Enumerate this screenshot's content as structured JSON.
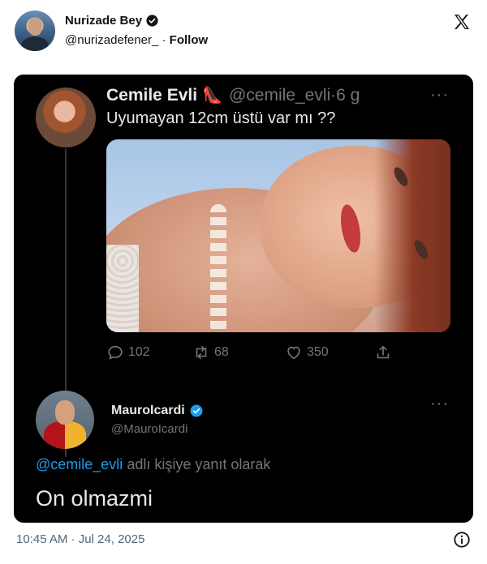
{
  "author": {
    "display_name": "Nurizade Bey",
    "handle": "@nurizadefener_",
    "separator": "·",
    "follow_label": "Follow"
  },
  "quoted": {
    "display_name": "Cemile Evli",
    "emoji": "👠",
    "handle": "@cemile_evli",
    "time": "·6 g",
    "text": "Uyumayan 12cm üstü var mı ??",
    "more": "···",
    "stats": {
      "replies": "102",
      "reposts": "68",
      "likes": "350"
    }
  },
  "reply": {
    "display_name": "MauroIcardi",
    "handle": "@MauroIcardi",
    "more": "···",
    "reply_mention": "@cemile_evli",
    "reply_suffix": " adlı kişiye yanıt olarak",
    "text": "On olmazmi"
  },
  "footer": {
    "timestamp": "10:45 AM · Jul 24, 2025"
  },
  "colors": {
    "verified": "#1d9bf0",
    "mention": "#1d9bf0",
    "card_bg": "#000000",
    "muted": "#71767b"
  }
}
